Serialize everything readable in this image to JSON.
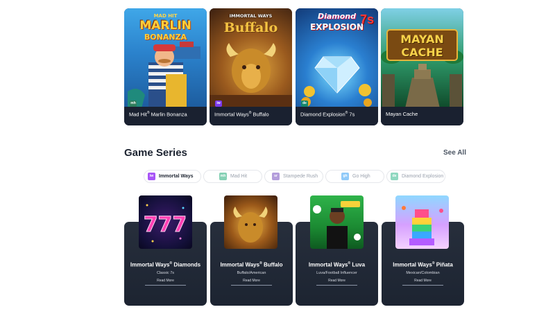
{
  "top_games": [
    {
      "name": "Mad Hit",
      "reg": "®",
      "name_rest": " Marlin Bonanza",
      "badge": "mh",
      "badge_color": "#2e7d5b",
      "logo_top": "MAD HIT",
      "logo_main": "MARLIN",
      "logo_sub": "BONANZA"
    },
    {
      "name": "Immortal Ways",
      "reg": "®",
      "name_rest": " Buffalo",
      "badge": "iw",
      "badge_color": "#7c3aed",
      "logo_top": "IMMORTAL WAYS",
      "logo_main": "Buffalo",
      "logo_sub": ""
    },
    {
      "name": "Diamond Explosion",
      "reg": "®",
      "name_rest": " 7s",
      "badge": "de",
      "badge_color": "#14866d",
      "logo_top": "Diamond",
      "logo_main": "EXPLOSION",
      "logo_sub": "7s"
    },
    {
      "name": "Mayan Cache",
      "reg": "",
      "name_rest": "",
      "badge": "",
      "badge_color": "",
      "logo_top": "",
      "logo_main": "MAYAN",
      "logo_sub": "CACHE"
    }
  ],
  "series": {
    "title": "Game Series",
    "see_all": "See All",
    "chips": [
      {
        "icon": "iw",
        "label": "Immortal Ways",
        "color": "#a855f7",
        "active": true
      },
      {
        "icon": "mh",
        "label": "Mad Hit",
        "color": "#86d1b5",
        "active": false
      },
      {
        "icon": "sr",
        "label": "Stampede Rush",
        "color": "#b39ddb",
        "active": false
      },
      {
        "icon": "gh",
        "label": "Go High",
        "color": "#90caf9",
        "active": false
      },
      {
        "icon": "de",
        "label": "Diamond Explosion",
        "color": "#8fd8c0",
        "active": false
      }
    ],
    "cards": [
      {
        "title": "Immortal Ways",
        "reg": "®",
        "title_rest": " Diamonds",
        "subtitle": "Classic 7s",
        "cta": "Read More"
      },
      {
        "title": "Immortal Ways",
        "reg": "®",
        "title_rest": " Buffalo",
        "subtitle": "Buffalo/American",
        "cta": "Read More"
      },
      {
        "title": "Immortal Ways",
        "reg": "®",
        "title_rest": " Luva",
        "subtitle": "Luva/Football Influencer",
        "cta": "Read More"
      },
      {
        "title": "Immortal Ways",
        "reg": "®",
        "title_rest": " Piñata",
        "subtitle": "Mexican/Colombian",
        "cta": "Read More"
      }
    ]
  },
  "colors": {
    "card_dark": "#1a2130",
    "heading": "#1c2330",
    "muted_chip_text": "#9aa1ad"
  }
}
